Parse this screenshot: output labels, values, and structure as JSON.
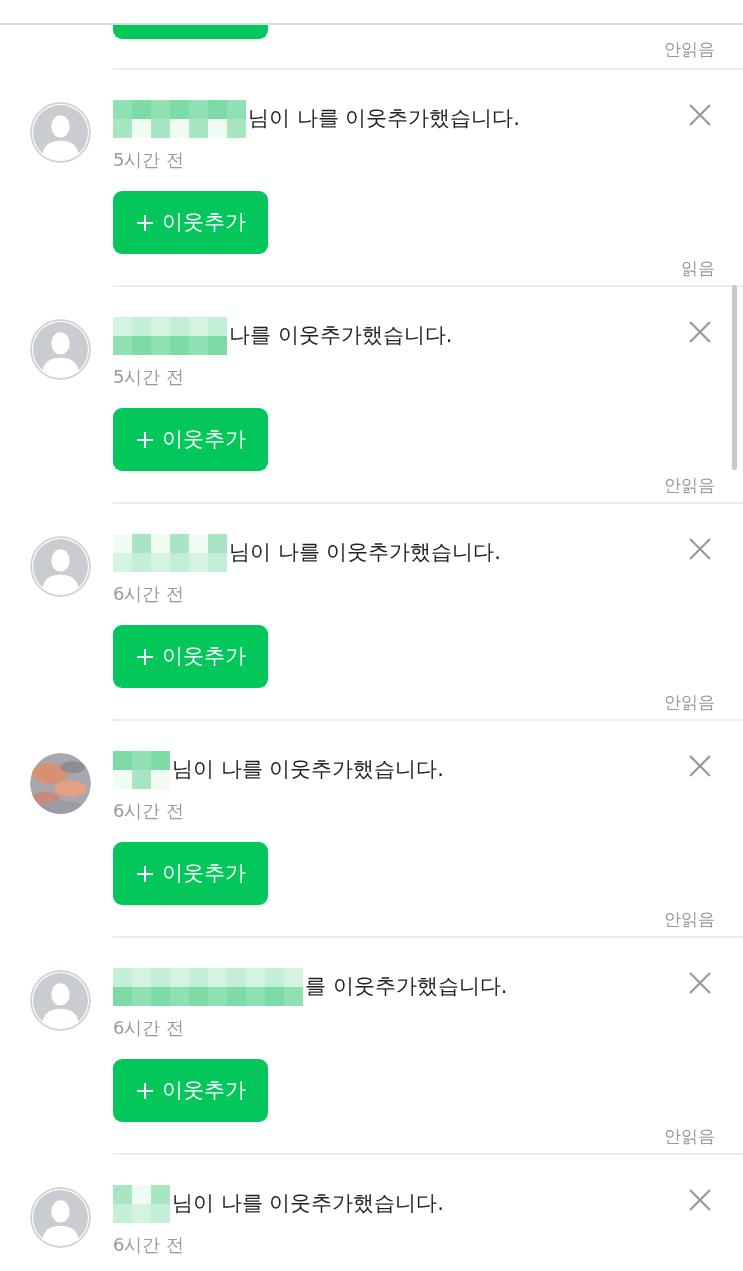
{
  "notifications": [
    {
      "status": "안읽음"
    },
    {
      "photo": false,
      "message": "님이 나를 이웃추가했습니다.",
      "time": "5시간 전",
      "button": "이웃추가",
      "status": "읽음"
    },
    {
      "photo": false,
      "message": "나를 이웃추가했습니다.",
      "time": "5시간 전",
      "button": "이웃추가",
      "status": "안읽음"
    },
    {
      "photo": false,
      "message": "님이 나를 이웃추가했습니다.",
      "time": "6시간 전",
      "button": "이웃추가",
      "status": "안읽음"
    },
    {
      "photo": true,
      "message": "님이 나를 이웃추가했습니다.",
      "time": "6시간 전",
      "button": "이웃추가",
      "status": "안읽음"
    },
    {
      "photo": false,
      "message": "를 이웃추가했습니다.",
      "time": "6시간 전",
      "button": "이웃추가",
      "status": "안읽음"
    },
    {
      "photo": false,
      "message": "님이 나를 이웃추가했습니다.",
      "time": "6시간 전"
    }
  ]
}
